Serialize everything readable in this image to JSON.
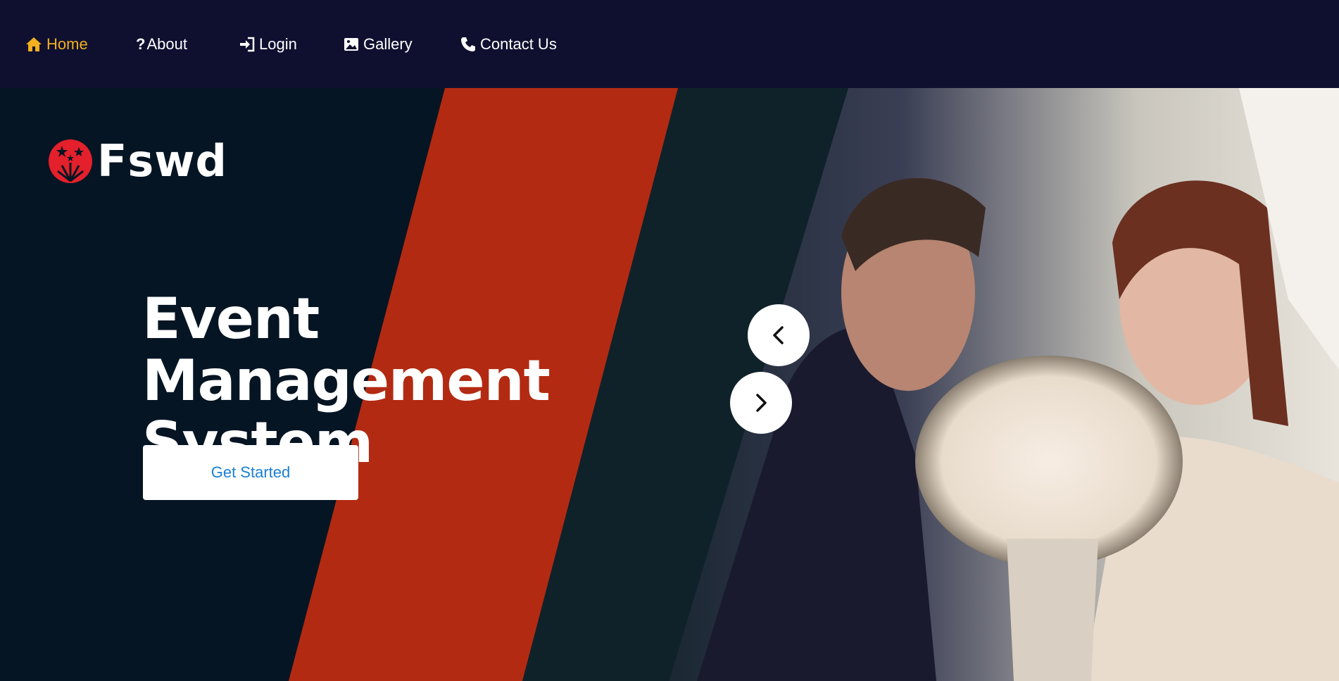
{
  "nav": {
    "items": [
      {
        "label": "Home",
        "icon": "home-icon",
        "active": true
      },
      {
        "label": "About",
        "icon": "question-icon",
        "active": false
      },
      {
        "label": "Login",
        "icon": "login-icon",
        "active": false
      },
      {
        "label": "Gallery",
        "icon": "image-icon",
        "active": false
      },
      {
        "label": "Contact Us",
        "icon": "phone-icon",
        "active": false
      }
    ]
  },
  "brand": {
    "name": "Fswd",
    "logo_icon": "fireworks-icon"
  },
  "hero": {
    "title_lines": [
      "Event",
      "Management",
      "System"
    ],
    "cta_label": "Get Started"
  },
  "carousel": {
    "prev_icon": "chevron-left-icon",
    "next_icon": "chevron-right-icon"
  },
  "colors": {
    "nav_bg": "#0f1030",
    "active": "#f2b01e",
    "accent_red": "#b32a12",
    "hero_dark": "#061523",
    "cta_text": "#1b7fd6"
  }
}
